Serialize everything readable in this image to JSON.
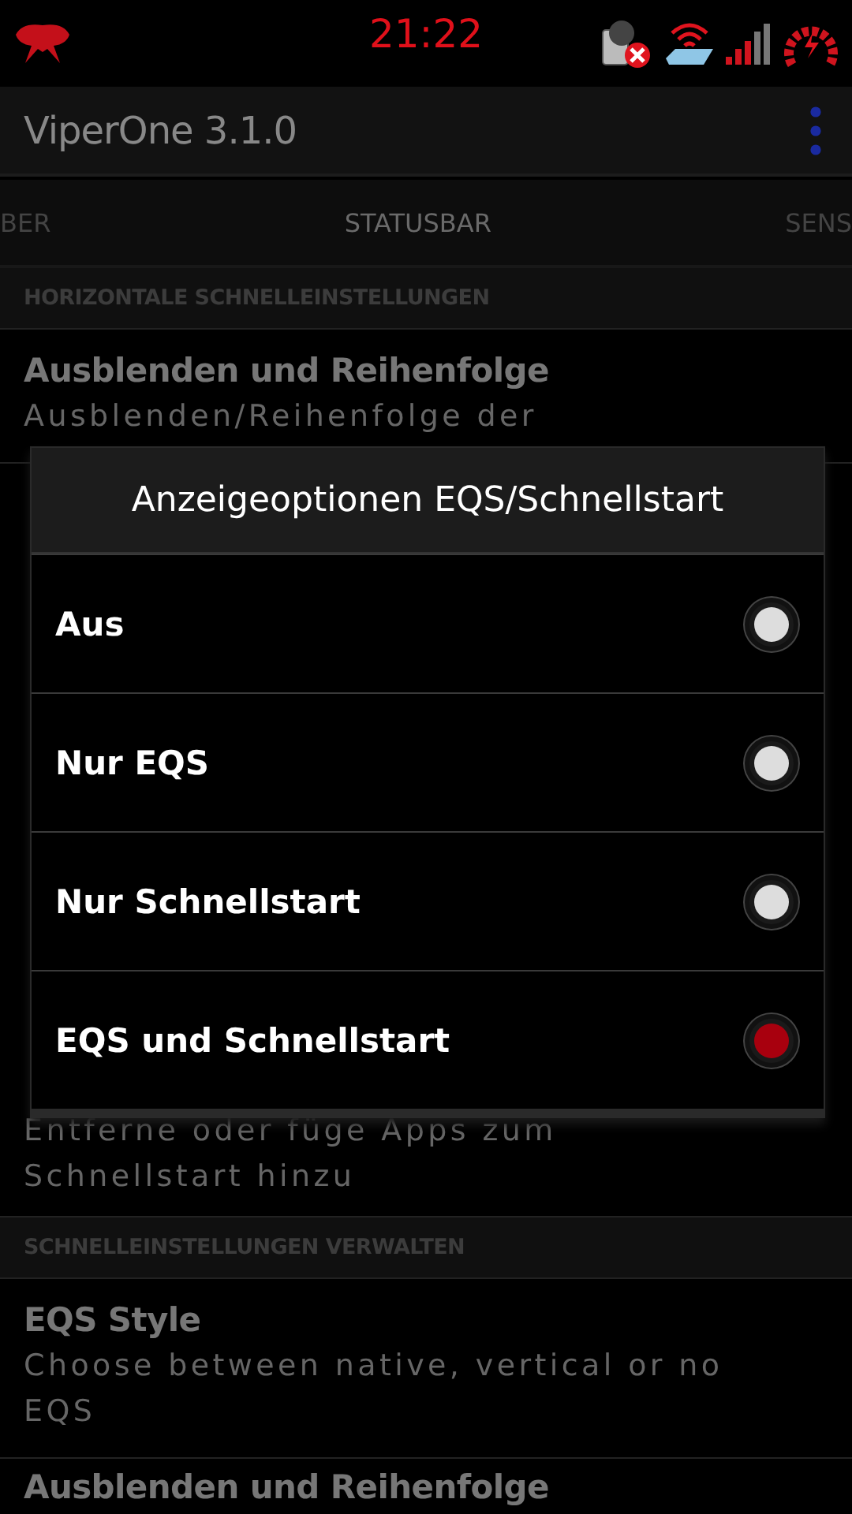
{
  "status_bar": {
    "time": "21:22"
  },
  "app_bar": {
    "title": "ViperOne 3.1.0"
  },
  "tabs": [
    {
      "label": "BER",
      "selected": false
    },
    {
      "label": "STATUSBAR",
      "selected": true
    },
    {
      "label": "SENS",
      "selected": false
    }
  ],
  "sections": [
    {
      "header": "HORIZONTALE SCHNELLEINSTELLUNGEN",
      "items": [
        {
          "title": "Ausblenden und Reihenfolge",
          "summary": "Ausblenden/Reihenfolge der"
        },
        {
          "summary": "Entferne oder füge Apps zum Schnellstart hinzu"
        }
      ]
    },
    {
      "header": "SCHNELLEINSTELLUNGEN VERWALTEN",
      "items": [
        {
          "title": "EQS Style",
          "summary": "Choose between native, vertical or no EQS"
        },
        {
          "title": "Ausblenden und Reihenfolge"
        }
      ]
    }
  ],
  "dialog": {
    "title": "Anzeigeoptionen EQS/Schnellstart",
    "options": [
      {
        "label": "Aus",
        "selected": false
      },
      {
        "label": "Nur EQS",
        "selected": false
      },
      {
        "label": "Nur Schnellstart",
        "selected": false
      },
      {
        "label": "EQS und Schnellstart",
        "selected": true
      }
    ]
  }
}
